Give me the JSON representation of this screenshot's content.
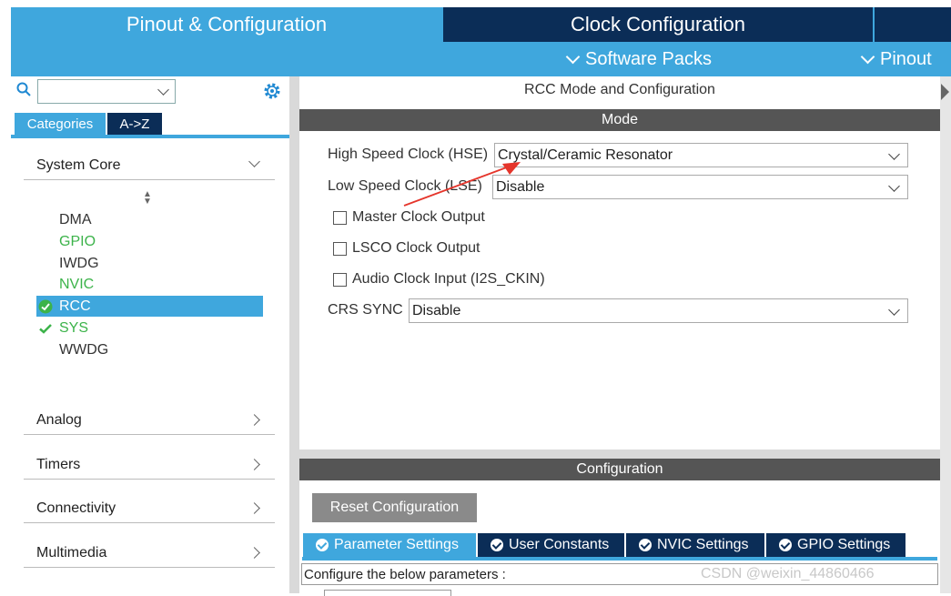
{
  "header": {
    "tabs": [
      "Pinout & Configuration",
      "Clock Configuration"
    ],
    "subnav": {
      "software_packs": "Software Packs",
      "pinout": "Pinout"
    }
  },
  "left_panel": {
    "search": {
      "value": ""
    },
    "tabs": {
      "categories": "Categories",
      "az": "A->Z"
    },
    "categories": [
      {
        "label": "System Core",
        "expanded": true
      },
      {
        "label": "Analog"
      },
      {
        "label": "Timers"
      },
      {
        "label": "Connectivity"
      },
      {
        "label": "Multimedia"
      }
    ],
    "system_core_items": [
      {
        "label": "DMA",
        "status": "none"
      },
      {
        "label": "GPIO",
        "status": "ok-text"
      },
      {
        "label": "IWDG",
        "status": "none"
      },
      {
        "label": "NVIC",
        "status": "ok-text"
      },
      {
        "label": "RCC",
        "status": "checked-selected"
      },
      {
        "label": "SYS",
        "status": "checked"
      },
      {
        "label": "WWDG",
        "status": "none"
      }
    ]
  },
  "mode_panel": {
    "title": "RCC Mode and Configuration",
    "section": "Mode",
    "fields": {
      "hse": {
        "label": "High Speed Clock (HSE)",
        "value": "Crystal/Ceramic Resonator"
      },
      "lse": {
        "label": "Low Speed Clock (LSE)",
        "value": "Disable"
      },
      "crs": {
        "label": "CRS SYNC",
        "value": "Disable"
      }
    },
    "checkboxes": [
      "Master Clock Output",
      "LSCO Clock Output",
      "Audio Clock Input (I2S_CKIN)"
    ]
  },
  "config_panel": {
    "section": "Configuration",
    "reset_button": "Reset Configuration",
    "tabs": [
      "Parameter Settings",
      "User Constants",
      "NVIC Settings",
      "GPIO Settings"
    ],
    "hint": "Configure the below parameters :"
  },
  "watermark": "CSDN @weixin_44860466",
  "colors": {
    "accent": "#3fa7dd",
    "navy": "#0b2d57",
    "ok": "#3cb34a",
    "section_bar": "#555555",
    "arrow": "#e5352b"
  }
}
